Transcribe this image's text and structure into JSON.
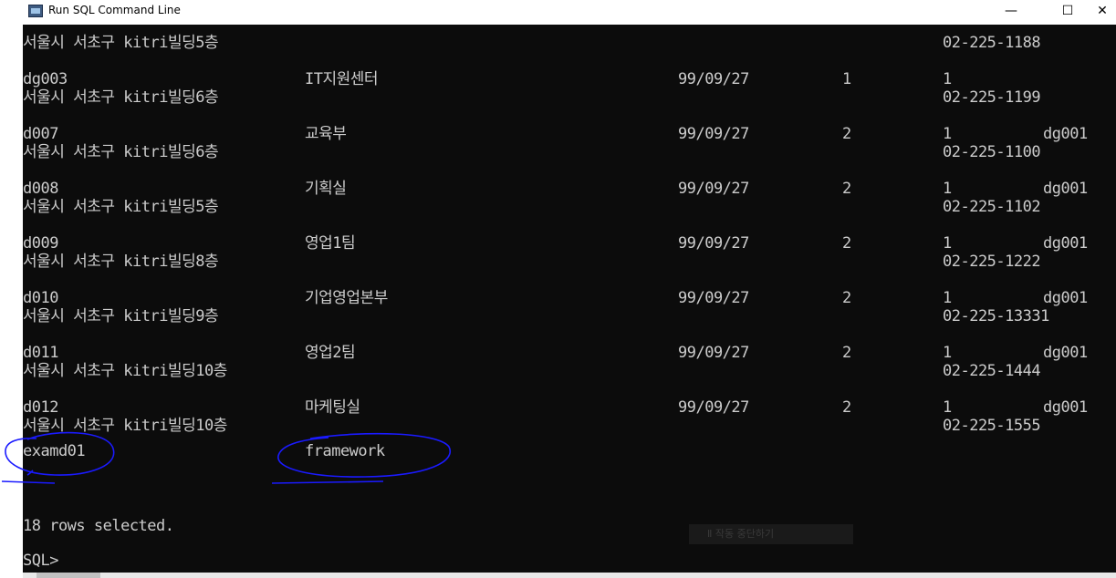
{
  "window": {
    "title": "Run SQL Command Line",
    "minimize_glyph": "—",
    "maximize_glyph": "☐",
    "close_glyph": "✕"
  },
  "console": {
    "text_color": "#cccccc",
    "background": "#0c0c0c",
    "rows": [
      {
        "code": "",
        "name": "",
        "date": "",
        "level": "",
        "flag": "",
        "parent": "",
        "address": "서울시 서초구 kitri빌딩5층",
        "phone": "02-225-1188"
      },
      {
        "code": "dg003",
        "name": "IT지원센터",
        "date": "99/09/27",
        "level": "1",
        "flag": "1",
        "parent": "",
        "address": "서울시 서초구 kitri빌딩6층",
        "phone": "02-225-1199"
      },
      {
        "code": "d007",
        "name": "교육부",
        "date": "99/09/27",
        "level": "2",
        "flag": "1",
        "parent": "dg001",
        "address": "서울시 서초구 kitri빌딩6층",
        "phone": "02-225-1100"
      },
      {
        "code": "d008",
        "name": "기획실",
        "date": "99/09/27",
        "level": "2",
        "flag": "1",
        "parent": "dg001",
        "address": "서울시 서초구 kitri빌딩5층",
        "phone": "02-225-1102"
      },
      {
        "code": "d009",
        "name": "영업1팀",
        "date": "99/09/27",
        "level": "2",
        "flag": "1",
        "parent": "dg001",
        "address": "서울시 서초구 kitri빌딩8층",
        "phone": "02-225-1222"
      },
      {
        "code": "d010",
        "name": "기업영업본부",
        "date": "99/09/27",
        "level": "2",
        "flag": "1",
        "parent": "dg001",
        "address": "서울시 서초구 kitri빌딩9층",
        "phone": "02-225-13331"
      },
      {
        "code": "d011",
        "name": "영업2팀",
        "date": "99/09/27",
        "level": "2",
        "flag": "1",
        "parent": "dg001",
        "address": "서울시 서초구 kitri빌딩10층",
        "phone": "02-225-1444"
      },
      {
        "code": "d012",
        "name": "마케팅실",
        "date": "99/09/27",
        "level": "2",
        "flag": "1",
        "parent": "dg001",
        "address": "서울시 서초구 kitri빌딩10층",
        "phone": "02-225-1555"
      }
    ],
    "extra_row": {
      "code": "examd01",
      "name": "framework"
    },
    "summary": "18 rows selected.",
    "prompt": "SQL>"
  },
  "overlay": {
    "tooltip_text": "Ⅱ 작동 중단하기",
    "annotation_color": "#1a1aff"
  }
}
